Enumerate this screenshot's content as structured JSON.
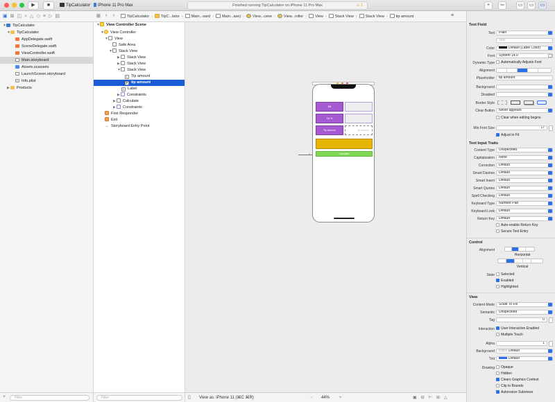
{
  "toolbar": {
    "scheme": "TipCalculator",
    "device": "iPhone 11 Pro Max",
    "status": "Finished running TipCalculator on iPhone 11 Pro Max",
    "warnings": "1",
    "plus": "+",
    "back": "⇦"
  },
  "breadcrumbs": [
    "TipCalculator",
    "TipC...lator",
    "Main...oard",
    "Main...ase)",
    "View...cene",
    "View...roller",
    "View",
    "Stack View",
    "Stack View",
    "tip amount"
  ],
  "navigator": {
    "items": [
      {
        "label": "TipCalculator",
        "level": 0,
        "kind": "project",
        "open": true
      },
      {
        "label": "TipCalculator",
        "level": 1,
        "kind": "folder",
        "open": true
      },
      {
        "label": "AppDelegate.swift",
        "level": 2,
        "kind": "swift"
      },
      {
        "label": "SceneDelegate.swift",
        "level": 2,
        "kind": "swift"
      },
      {
        "label": "ViewController.swift",
        "level": 2,
        "kind": "swift"
      },
      {
        "label": "Main.storyboard",
        "level": 2,
        "kind": "storyboard",
        "selected": true
      },
      {
        "label": "Assets.xcassets",
        "level": 2,
        "kind": "assets"
      },
      {
        "label": "LaunchScreen.storyboard",
        "level": 2,
        "kind": "storyboard"
      },
      {
        "label": "Info.plist",
        "level": 2,
        "kind": "plist"
      },
      {
        "label": "Products",
        "level": 1,
        "kind": "folder",
        "open": false
      }
    ],
    "filter_placeholder": "Filter"
  },
  "outline": {
    "items": [
      {
        "label": "View Controller Scene",
        "level": 0,
        "bold": true
      },
      {
        "label": "View Controller",
        "level": 1
      },
      {
        "label": "View",
        "level": 2
      },
      {
        "label": "Safe Area",
        "level": 3
      },
      {
        "label": "Stack View",
        "level": 3
      },
      {
        "label": "Stack View",
        "level": 4
      },
      {
        "label": "Stack View",
        "level": 4
      },
      {
        "label": "Stack View",
        "level": 4
      },
      {
        "label": "Tip amount",
        "level": 5
      },
      {
        "label": "tip amount",
        "level": 5,
        "selected": true
      },
      {
        "label": "Label",
        "level": 4
      },
      {
        "label": "Constraints",
        "level": 4
      },
      {
        "label": "Calculate",
        "level": 3
      },
      {
        "label": "Constraints",
        "level": 3
      },
      {
        "label": "First Responder",
        "level": 1
      },
      {
        "label": "Exit",
        "level": 1
      },
      {
        "label": "Storyboard Entry Point",
        "level": 1
      }
    ],
    "filter_placeholder": "Filter"
  },
  "canvas": {
    "phone_rows": [
      {
        "left": "Bill",
        "right": ""
      },
      {
        "left": "Tip %",
        "right": ""
      },
      {
        "left": "Tip amount",
        "right": "tip amount"
      }
    ],
    "calculate_label": "Calculate",
    "view_as": "View as: iPhone 11 (⌘C ⌘R)",
    "zoom": "44%",
    "colors": {
      "purple": "#a55ad1",
      "yellow": "#e5b400",
      "green": "#7fd957"
    }
  },
  "inspector": {
    "textfield_title": "Text Field",
    "text_label": "Text",
    "text_value": "Plain",
    "text_placeholder_field": "Text",
    "color_label": "Color",
    "color_value": "Default (Label Color)",
    "font_label": "Font",
    "font_value": "System 14.0",
    "dynamic_type_label": "Dynamic Type",
    "dynamic_type_value": "Automatically Adjusts Font",
    "alignment_label": "Alignment",
    "placeholder_label": "Placeholder",
    "placeholder_value": "tip amount",
    "background_label": "Background",
    "disabled_label": "Disabled",
    "border_style_label": "Border Style",
    "clear_button_label": "Clear Button",
    "clear_button_value": "Never appears",
    "clear_editing": "Clear when editing begins",
    "min_font_label": "Min Font Size",
    "min_font_value": "17",
    "adjust_fit": "Adjust to Fit",
    "traits_title": "Text Input Traits",
    "traits": [
      {
        "label": "Content Type",
        "value": "Unspecified"
      },
      {
        "label": "Capitalization",
        "value": "None"
      },
      {
        "label": "Correction",
        "value": "Default"
      },
      {
        "label": "Smart Dashes",
        "value": "Default"
      },
      {
        "label": "Smart Insert",
        "value": "Default"
      },
      {
        "label": "Smart Quotes",
        "value": "Default"
      },
      {
        "label": "Spell Checking",
        "value": "Default"
      },
      {
        "label": "Keyboard Type",
        "value": "Number Pad"
      },
      {
        "label": "Keyboard Look",
        "value": "Default"
      },
      {
        "label": "Return Key",
        "value": "Default"
      }
    ],
    "auto_return": "Auto-enable Return Key",
    "secure_entry": "Secure Text Entry",
    "control_title": "Control",
    "control_alignment_label": "Alignment",
    "horizontal": "Horizontal",
    "vertical": "Vertical",
    "state_label": "State",
    "state_selected": "Selected",
    "state_enabled": "Enabled",
    "state_highlighted": "Highlighted",
    "view_title": "View",
    "content_mode_label": "Content Mode",
    "content_mode_value": "Scale To Fill",
    "semantic_label": "Semantic",
    "semantic_value": "Unspecified",
    "tag_label": "Tag",
    "tag_value": "0",
    "interaction_label": "Interaction",
    "user_interaction": "User Interaction Enabled",
    "multiple_touch": "Multiple Touch",
    "alpha_label": "Alpha",
    "alpha_value": "1",
    "bg_label": "Background",
    "bg_value": "Default",
    "tint_label": "Tint",
    "tint_value": "Default",
    "drawing_label": "Drawing",
    "opaque": "Opaque",
    "hidden": "Hidden",
    "clears_ctx": "Clears Graphics Context",
    "clip_bounds": "Clip to Bounds",
    "autoresize": "Autoresize Subviews"
  }
}
